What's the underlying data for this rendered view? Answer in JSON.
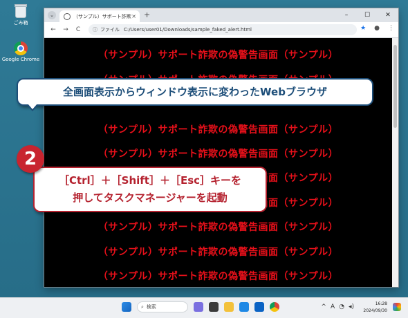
{
  "desktop": {
    "icons": [
      {
        "label": "ごみ箱"
      },
      {
        "label": "Google Chrome"
      }
    ]
  },
  "browser": {
    "tab_title": "（サンプル）サポート詐欺の偽警告",
    "new_tab": "+",
    "window_controls": [
      "–",
      "☐",
      "✕"
    ],
    "address_prefix": "ファイル",
    "url": "C:/Users/user01/Downloads/sample_faked_alert.html",
    "nav": [
      "←",
      "→",
      "C"
    ]
  },
  "page": {
    "warning_line": "（サンプル）サポート詐欺の偽警告画面（サンプル）"
  },
  "callouts": {
    "top": "全画面表示からウィンドウ表示に変わったWebブラウザ",
    "step_number": "2",
    "step_line1": "［Ctrl］＋［Shift］＋［Esc］キーを",
    "step_line2": "押してタスクマネージャーを起動"
  },
  "taskbar": {
    "search_placeholder": "検索",
    "time": "16:28",
    "date": "2024/09/30"
  }
}
